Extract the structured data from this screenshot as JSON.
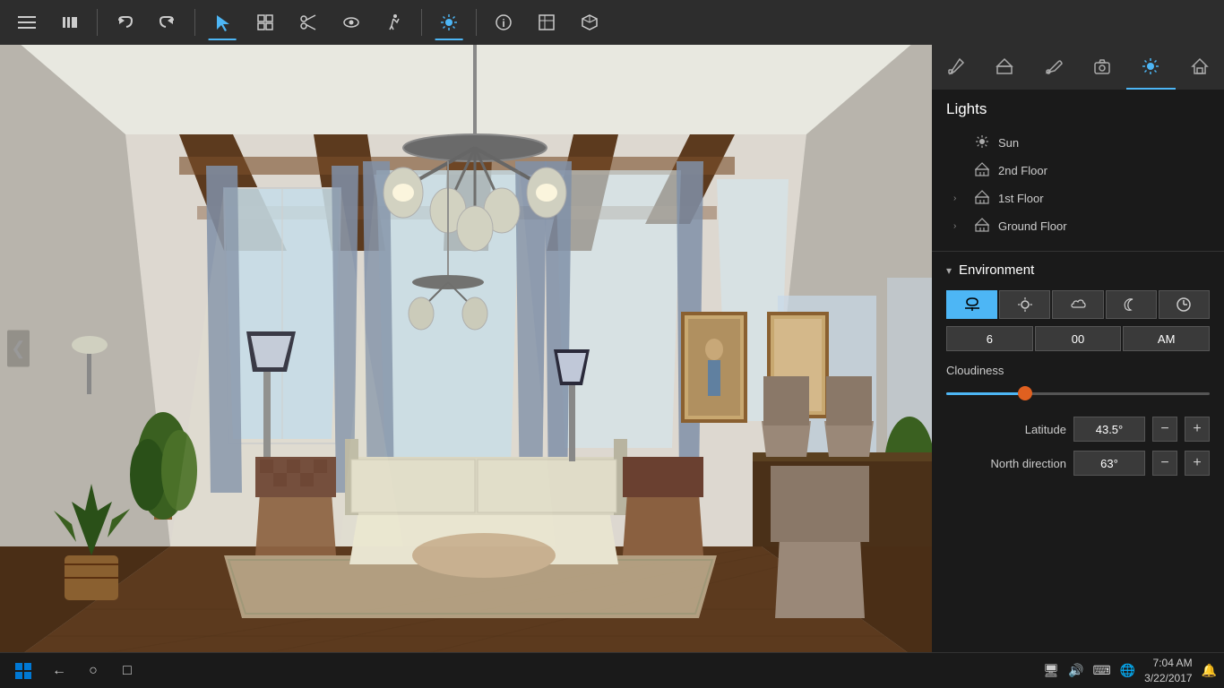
{
  "toolbar": {
    "buttons": [
      {
        "id": "menu",
        "icon": "≡",
        "active": false,
        "label": "menu"
      },
      {
        "id": "library",
        "icon": "📚",
        "active": false,
        "label": "library"
      },
      {
        "id": "undo",
        "icon": "↩",
        "active": false,
        "label": "undo"
      },
      {
        "id": "redo",
        "icon": "↪",
        "active": false,
        "label": "redo"
      },
      {
        "id": "select",
        "icon": "↖",
        "active": true,
        "label": "select"
      },
      {
        "id": "objects",
        "icon": "⊞",
        "active": false,
        "label": "objects"
      },
      {
        "id": "scissors",
        "icon": "✂",
        "active": false,
        "label": "scissors"
      },
      {
        "id": "eye",
        "icon": "👁",
        "active": false,
        "label": "eye"
      },
      {
        "id": "walk",
        "icon": "🚶",
        "active": false,
        "label": "walk"
      },
      {
        "id": "sun",
        "icon": "☀",
        "active": true,
        "label": "sun-toolbar"
      },
      {
        "id": "info",
        "icon": "ℹ",
        "active": false,
        "label": "info"
      },
      {
        "id": "view",
        "icon": "⬚",
        "active": false,
        "label": "view"
      },
      {
        "id": "cube",
        "icon": "⬡",
        "active": false,
        "label": "cube"
      }
    ]
  },
  "panel_tabs": [
    {
      "id": "tools",
      "icon": "🔧",
      "active": false,
      "label": "tools-tab"
    },
    {
      "id": "structure",
      "icon": "🏠",
      "active": false,
      "label": "structure-tab"
    },
    {
      "id": "paint",
      "icon": "✏",
      "active": false,
      "label": "paint-tab"
    },
    {
      "id": "camera",
      "icon": "📷",
      "active": false,
      "label": "camera-tab"
    },
    {
      "id": "lights-tab",
      "icon": "☀",
      "active": true,
      "label": "lights-panel-tab"
    },
    {
      "id": "home2",
      "icon": "⌂",
      "active": false,
      "label": "home-tab"
    }
  ],
  "lights": {
    "title": "Lights",
    "items": [
      {
        "id": "sun",
        "label": "Sun",
        "hasExpand": false,
        "icon": "☀"
      },
      {
        "id": "2nd-floor",
        "label": "2nd Floor",
        "hasExpand": false,
        "icon": "🏢"
      },
      {
        "id": "1st-floor",
        "label": "1st Floor",
        "hasExpand": true,
        "icon": "🏢"
      },
      {
        "id": "ground-floor",
        "label": "Ground Floor",
        "hasExpand": true,
        "icon": "🏢"
      }
    ]
  },
  "environment": {
    "title": "Environment",
    "time_presets": [
      {
        "id": "sunrise",
        "icon": "🌅",
        "active": true
      },
      {
        "id": "day",
        "icon": "☀",
        "active": false
      },
      {
        "id": "cloudy",
        "icon": "☁",
        "active": false
      },
      {
        "id": "night",
        "icon": "☾",
        "active": false
      },
      {
        "id": "clock",
        "icon": "⏰",
        "active": false
      }
    ],
    "time_hour": "6",
    "time_min": "00",
    "time_ampm": "AM",
    "cloudiness_label": "Cloudiness",
    "cloudiness_value": 30,
    "latitude_label": "Latitude",
    "latitude_value": "43.5°",
    "north_direction_label": "North direction",
    "north_direction_value": "63°"
  },
  "viewport": {
    "left_arrow": "❮"
  },
  "taskbar": {
    "start_icon": "⊞",
    "icons": [
      "←",
      "○",
      "□"
    ],
    "sys_icons": [
      "🖥",
      "🔊",
      "⌨",
      "🌐"
    ],
    "clock": "7:04 AM",
    "date": "3/22/2017",
    "notification": "🔔"
  }
}
